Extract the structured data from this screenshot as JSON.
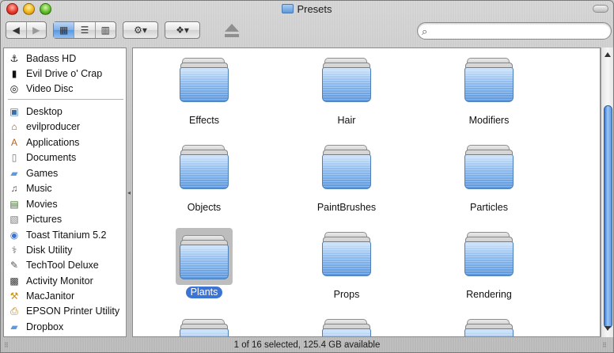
{
  "window": {
    "title": "Presets"
  },
  "toolbar": {
    "back_icon": "back-arrow-icon",
    "forward_icon": "forward-arrow-icon",
    "view_modes": [
      "icon-view",
      "list-view",
      "column-view"
    ],
    "active_view": "icon-view",
    "action_icon": "gear-icon",
    "dropbox_icon": "dropbox-icon",
    "eject_icon": "eject-icon",
    "search": {
      "value": "",
      "placeholder": ""
    }
  },
  "sidebar": {
    "devices": [
      {
        "label": "Badass HD",
        "icon": "hard-disk-icon"
      },
      {
        "label": "Evil Drive o' Crap",
        "icon": "external-drive-icon"
      },
      {
        "label": "Video Disc",
        "icon": "disc-icon"
      }
    ],
    "places": [
      {
        "label": "Desktop",
        "icon": "desktop-icon"
      },
      {
        "label": "evilproducer",
        "icon": "home-icon"
      },
      {
        "label": "Applications",
        "icon": "applications-icon"
      },
      {
        "label": "Documents",
        "icon": "documents-icon"
      },
      {
        "label": "Games",
        "icon": "folder-icon"
      },
      {
        "label": "Music",
        "icon": "music-icon"
      },
      {
        "label": "Movies",
        "icon": "movies-icon"
      },
      {
        "label": "Pictures",
        "icon": "pictures-icon"
      },
      {
        "label": "Toast Titanium 5.2",
        "icon": "toast-icon"
      },
      {
        "label": "Disk Utility",
        "icon": "disk-utility-icon"
      },
      {
        "label": "TechTool Deluxe",
        "icon": "techtool-icon"
      },
      {
        "label": "Activity Monitor",
        "icon": "activity-monitor-icon"
      },
      {
        "label": "MacJanitor",
        "icon": "macjanitor-icon"
      },
      {
        "label": "EPSON Printer Utility",
        "icon": "printer-icon"
      },
      {
        "label": "Dropbox",
        "icon": "folder-icon"
      }
    ]
  },
  "content": {
    "items": [
      {
        "label": "Effects",
        "selected": false
      },
      {
        "label": "Hair",
        "selected": false
      },
      {
        "label": "Modifiers",
        "selected": false
      },
      {
        "label": "Objects",
        "selected": false
      },
      {
        "label": "PaintBrushes",
        "selected": false
      },
      {
        "label": "Particles",
        "selected": false
      },
      {
        "label": "Plants",
        "selected": true
      },
      {
        "label": "Props",
        "selected": false
      },
      {
        "label": "Rendering",
        "selected": false
      },
      {
        "label": "",
        "selected": false
      },
      {
        "label": "",
        "selected": false
      },
      {
        "label": "",
        "selected": false
      }
    ]
  },
  "status": {
    "text": "1 of 16 selected, 125.4 GB available"
  },
  "colors": {
    "selection": "#3b74d4",
    "folder_blue": "#8dbbee",
    "scroll_thumb": "#5b95e0"
  }
}
